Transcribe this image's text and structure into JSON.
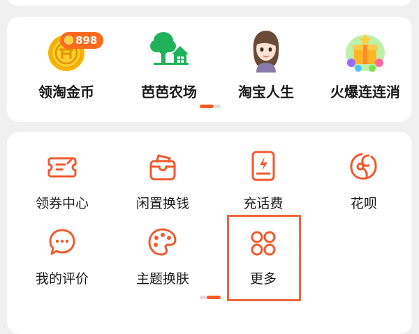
{
  "games": {
    "items": [
      {
        "label": "领淘金币",
        "icon": "gold-coin-icon",
        "badge": "898"
      },
      {
        "label": "芭芭农场",
        "icon": "farm-tree-house-icon"
      },
      {
        "label": "淘宝人生",
        "icon": "avatar-girl-icon"
      },
      {
        "label": "火爆连连消",
        "icon": "gift-box-icon"
      }
    ]
  },
  "services": {
    "items": [
      {
        "label": "领券中心",
        "icon": "coupon-icon"
      },
      {
        "label": "闲置换钱",
        "icon": "idle-swap-box-icon"
      },
      {
        "label": "充话费",
        "icon": "phone-recharge-icon"
      },
      {
        "label": "花呗",
        "icon": "huabei-icon"
      },
      {
        "label": "我的评价",
        "icon": "comment-bubble-icon"
      },
      {
        "label": "主题换肤",
        "icon": "palette-icon"
      },
      {
        "label": "更多",
        "icon": "four-circles-icon"
      }
    ]
  },
  "colors": {
    "accent": "#ff5a1f",
    "icon_stroke": "#ef5a2e",
    "highlight": "#e9673a",
    "badge": "#ff6a1c",
    "background": "#f0f0f1"
  }
}
